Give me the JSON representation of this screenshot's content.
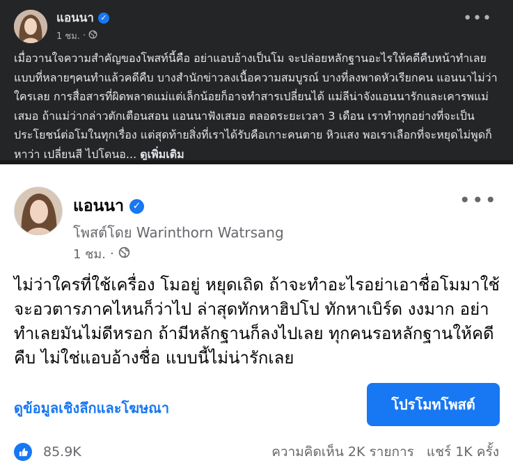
{
  "top_post": {
    "author": "แอนนา",
    "time": "1 ชม.",
    "body": "เมื่อวานใจความสำคัญของโพสท์นี้คือ อย่าแอบอ้างเป็นโม จะปล่อยหลักฐานอะไรให้คดีคืบหน้าทำเลย แบบที่หลายๆคนทำแล้วคดีคืบ บางสำนักข่าวลงเนื้อความสมบูรณ์ บางที่ลงพาดหัวเรียกคน แอนนาไม่ว่าใครเลย  การสื่อสารที่ผิดพลาดแม่แต่เล็กน้อยก็อาจทำสารเปลี่ยนได้ แม่ลีน่าจังแอนนารักและเคารพแม่เสมอ ถ้าแม่ว่ากล่าวตักเตือนสอน แอนนาฟังเสมอ ตลอดระยะเวลา 3 เดือน เราทำทุกอย่างที่จะเป็นประโยชน์ต่อโมในทุกเรื่อง แต่สุดท้ายสิ่งที่เราได้รับคือเกาะคนตาย หิวแสง พอเราเลือกที่จะหยุดไม่พูดก็หาว่า เปลี่ยนสี ไปโดนอ...",
    "see_more": "ดูเพิ่มเติม"
  },
  "shared_post": {
    "author": "แอนนา",
    "posted_by": "โพสต์โดย Warinthorn Watrsang",
    "time": "1 ชม.",
    "body": "ไม่ว่าใครที่ใช้เครื่อง โมอยู่ หยุดเถิด ถ้าจะทำอะไรอย่าเอาชื่อโมมาใช้ จะอวตารภาคไหนก็ว่าไป ล่าสุดทักหาฮิปโป ทักหาเบิร์ด งงมาก อย่าทำเลยมันไม่ดีหรอก ถ้ามีหลักฐานก็ลงไปเลย ทุกคนรอหลักฐานให้คดีคืบ ไม่ใช่แอบอ้างชื่อ แบบนี้ไม่น่ารักเลย",
    "insights_link": "ดูข้อมูลเชิงลึกและโฆษณา",
    "promote_button": "โปรโมทโพสต์",
    "likes": "85.9K",
    "comments": "ความคิดเห็น 2K รายการ",
    "shares": "แชร์ 1K ครั้ง"
  },
  "colors": {
    "dark_bg": "#242526",
    "facebook_blue": "#1877f2",
    "secondary_text": "#65676b"
  },
  "icons": [
    "verified-badge-icon",
    "globe-icon",
    "more-options-icon",
    "like-icon"
  ]
}
